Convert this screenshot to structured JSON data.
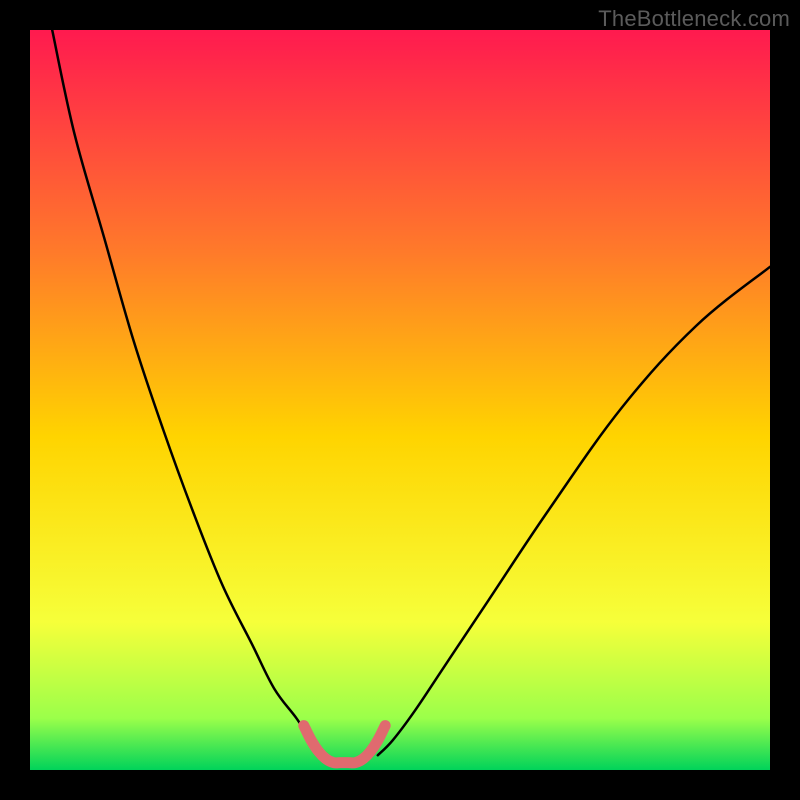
{
  "watermark": "TheBottleneck.com",
  "chart_data": {
    "type": "line",
    "title": "",
    "xlabel": "",
    "ylabel": "",
    "xlim": [
      0,
      100
    ],
    "ylim": [
      0,
      100
    ],
    "grid": false,
    "gradient_colors": {
      "top": "#ff1a4f",
      "upper_mid": "#ff7a2a",
      "mid": "#ffd400",
      "lower_mid": "#f6ff3a",
      "near_bottom": "#9bff4a",
      "bottom": "#00d35a"
    },
    "series": [
      {
        "name": "curve-left",
        "stroke": "#000000",
        "x": [
          3,
          6,
          10,
          14,
          18,
          22,
          26,
          30,
          33,
          36,
          38,
          40
        ],
        "values": [
          100,
          86,
          72,
          58,
          46,
          35,
          25,
          17,
          11,
          7,
          4,
          2
        ]
      },
      {
        "name": "curve-right",
        "stroke": "#000000",
        "x": [
          47,
          49,
          52,
          56,
          62,
          70,
          80,
          90,
          100
        ],
        "values": [
          2,
          4,
          8,
          14,
          23,
          35,
          49,
          60,
          68
        ]
      },
      {
        "name": "valley-highlight",
        "stroke": "#e06a6f",
        "x": [
          37,
          38,
          39,
          40,
          41,
          42,
          43,
          44,
          45,
          46,
          47,
          48
        ],
        "values": [
          6,
          4,
          2.5,
          1.5,
          1,
          1,
          1,
          1,
          1.5,
          2.5,
          4,
          6
        ]
      }
    ],
    "annotations": []
  }
}
